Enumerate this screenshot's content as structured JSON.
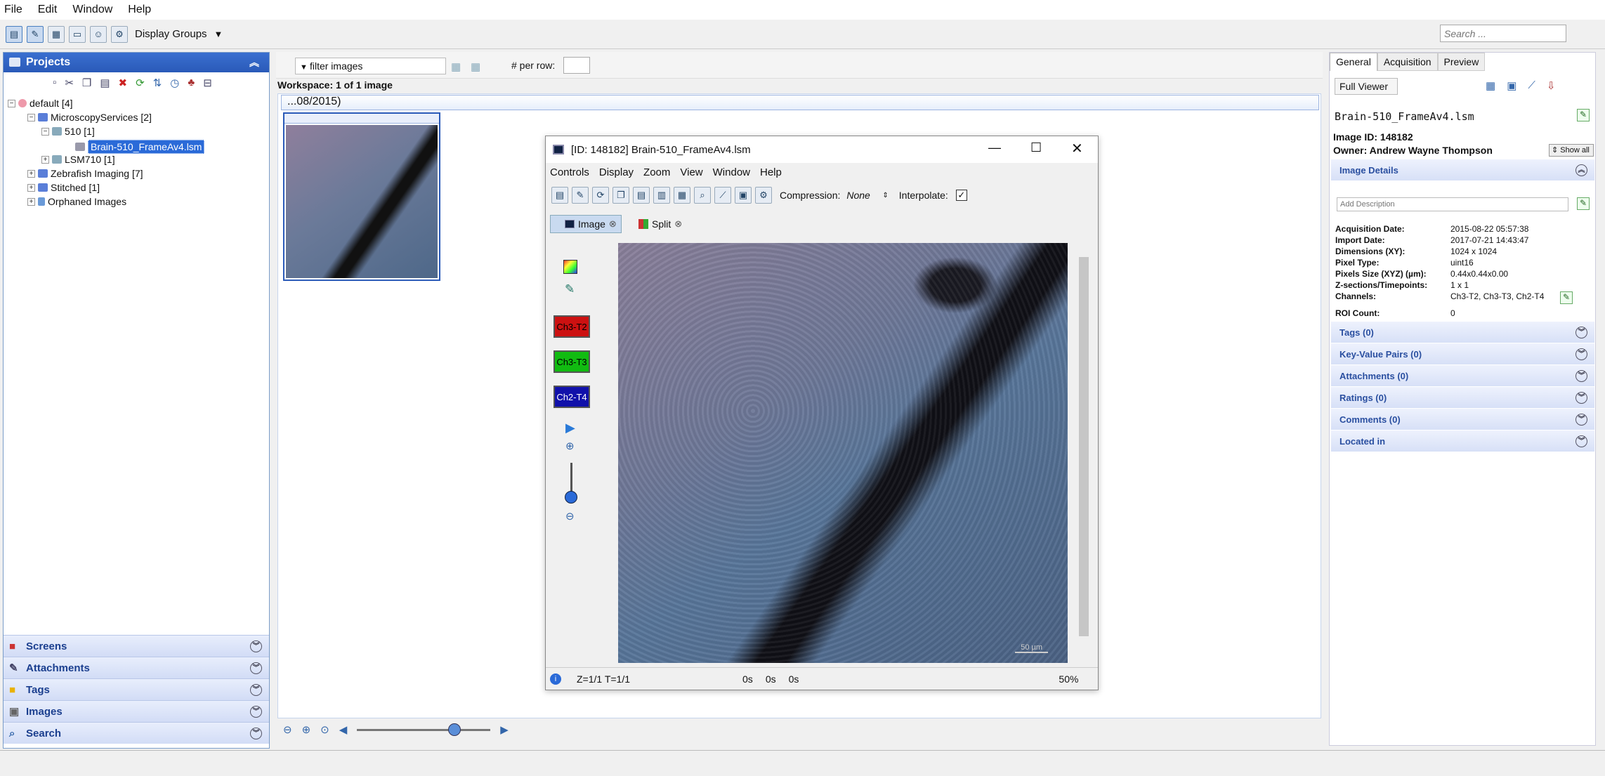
{
  "menubar": [
    "File",
    "Edit",
    "Window",
    "Help"
  ],
  "toolbar": {
    "display_groups": "Display Groups",
    "search_placeholder": "Search ..."
  },
  "projects": {
    "title": "Projects",
    "tree": [
      {
        "label": "default [4]"
      },
      {
        "label": "MicroscopyServices [2]"
      },
      {
        "label": "510 [1]"
      },
      {
        "label": "Brain-510_FrameAv4.lsm"
      },
      {
        "label": "LSM710 [1]"
      },
      {
        "label": "Zebrafish Imaging [7]"
      },
      {
        "label": "Stitched [1]"
      },
      {
        "label": "Orphaned Images"
      }
    ],
    "sections": [
      "Screens",
      "Attachments",
      "Tags",
      "Images",
      "Search"
    ]
  },
  "workspace": {
    "filter": "filter images",
    "per_row_label": "# per row:",
    "summary": "Workspace: 1 of 1 image",
    "group_label": "...08/2015)"
  },
  "viewer": {
    "title": "[ID: 148182] Brain-510_FrameAv4.lsm",
    "menu": [
      "Controls",
      "Display",
      "Zoom",
      "View",
      "Window",
      "Help"
    ],
    "compression_label": "Compression:",
    "compression_value": "None",
    "interpolate_label": "Interpolate:",
    "tabs": [
      "Image",
      "Split"
    ],
    "channels": [
      {
        "name": "Ch3-T2",
        "color": "#cc1111"
      },
      {
        "name": "Ch3-T3",
        "color": "#11bb11"
      },
      {
        "name": "Ch2-T4",
        "color": "#1111aa"
      }
    ],
    "scale": "50 µm",
    "status": {
      "zt": "Z=1/1 T=1/1",
      "t1": "0s",
      "t2": "0s",
      "t3": "0s",
      "zoom": "50%"
    }
  },
  "right": {
    "tabs": [
      "General",
      "Acquisition",
      "Preview"
    ],
    "full_viewer": "Full Viewer",
    "name": "Brain-510_FrameAv4.lsm",
    "image_id": "Image ID: 148182",
    "owner": "Owner: Andrew Wayne Thompson",
    "show_all": "Show all",
    "image_details": "Image Details",
    "desc_placeholder": "Add Description",
    "details": [
      {
        "k": "Acquisition Date:",
        "v": "2015-08-22 05:57:38"
      },
      {
        "k": "Import Date:",
        "v": "2017-07-21 14:43:47"
      },
      {
        "k": "Dimensions (XY):",
        "v": "1024 x 1024"
      },
      {
        "k": "Pixel Type:",
        "v": "uint16"
      },
      {
        "k": "Pixels Size (XYZ) (µm):",
        "v": "0.44x0.44x0.00"
      },
      {
        "k": "Z-sections/Timepoints:",
        "v": "1 x 1"
      },
      {
        "k": "Channels:",
        "v": "Ch3-T2, Ch3-T3, Ch2-T4"
      },
      {
        "k": "ROI Count:",
        "v": "0"
      }
    ],
    "sections": [
      "Tags (0)",
      "Key-Value Pairs (0)",
      "Attachments (0)",
      "Ratings (0)",
      "Comments (0)",
      "Located in"
    ]
  }
}
